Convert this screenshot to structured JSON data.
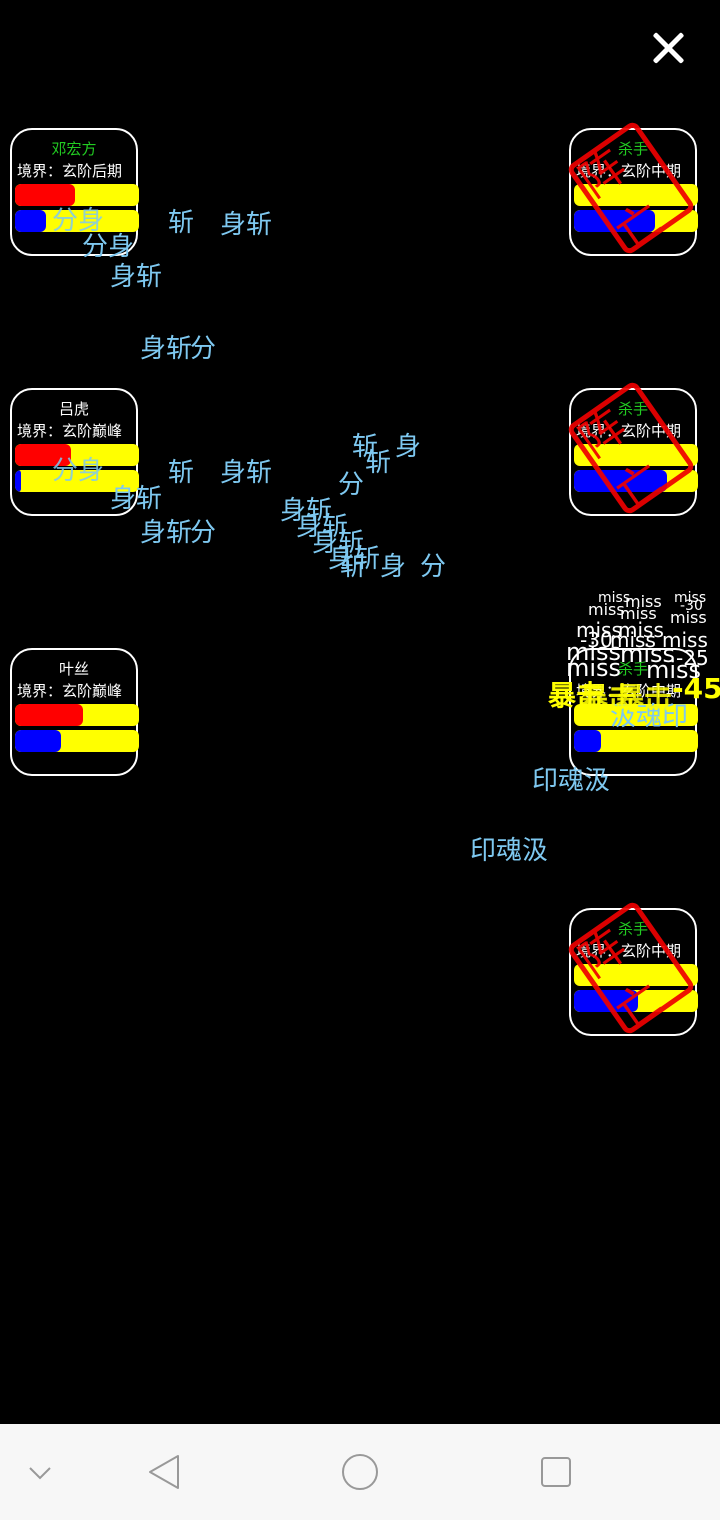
{
  "heroes": [
    {
      "name": "邓宏方",
      "realm": "境界：玄阶后期",
      "hp": 0.48,
      "mp": 0.25,
      "name_color": "#22cc22"
    },
    {
      "name": "吕虎",
      "realm": "境界：玄阶巅峰",
      "hp": 0.45,
      "mp": 0.05,
      "name_color": "#ffffff"
    },
    {
      "name": "叶丝",
      "realm": "境界：玄阶巅峰",
      "hp": 0.55,
      "mp": 0.37,
      "name_color": "#ffffff"
    }
  ],
  "enemies": [
    {
      "name": "杀手",
      "realm": "境界：玄阶中期",
      "hp": 0.0,
      "mp": 0.65,
      "stamp": "阵亡"
    },
    {
      "name": "杀手",
      "realm": "境界：玄阶中期",
      "hp": 0.0,
      "mp": 0.75,
      "stamp": "阵亡"
    },
    {
      "name": "杀手",
      "realm": "境界：玄阶中期",
      "hp": 0.0,
      "mp": 0.22
    },
    {
      "name": "杀手",
      "realm": "境界：玄阶中期",
      "hp": 0.0,
      "mp": 0.52,
      "stamp": "阵亡"
    }
  ],
  "effects": {
    "skill_a": [
      "斩",
      "身斩",
      "分身",
      "身斩",
      "身",
      "斩",
      "分"
    ],
    "skill_b": [
      "印魂汲",
      "印魂汲",
      "汲魂印"
    ],
    "miss": "miss",
    "dmg": [
      "-30",
      "-25",
      "-45"
    ],
    "crit": "暴击"
  },
  "colors": {
    "hp": "#ff0000",
    "mp": "#0000ff",
    "bar_bg": "#ffff00",
    "effect": "#7ec8f0",
    "stamp": "#ee0000"
  },
  "icons": {
    "close": "close-icon",
    "back": "back-icon",
    "home": "home-icon",
    "recent": "recent-apps-icon",
    "collapse": "chevron-down-icon"
  }
}
